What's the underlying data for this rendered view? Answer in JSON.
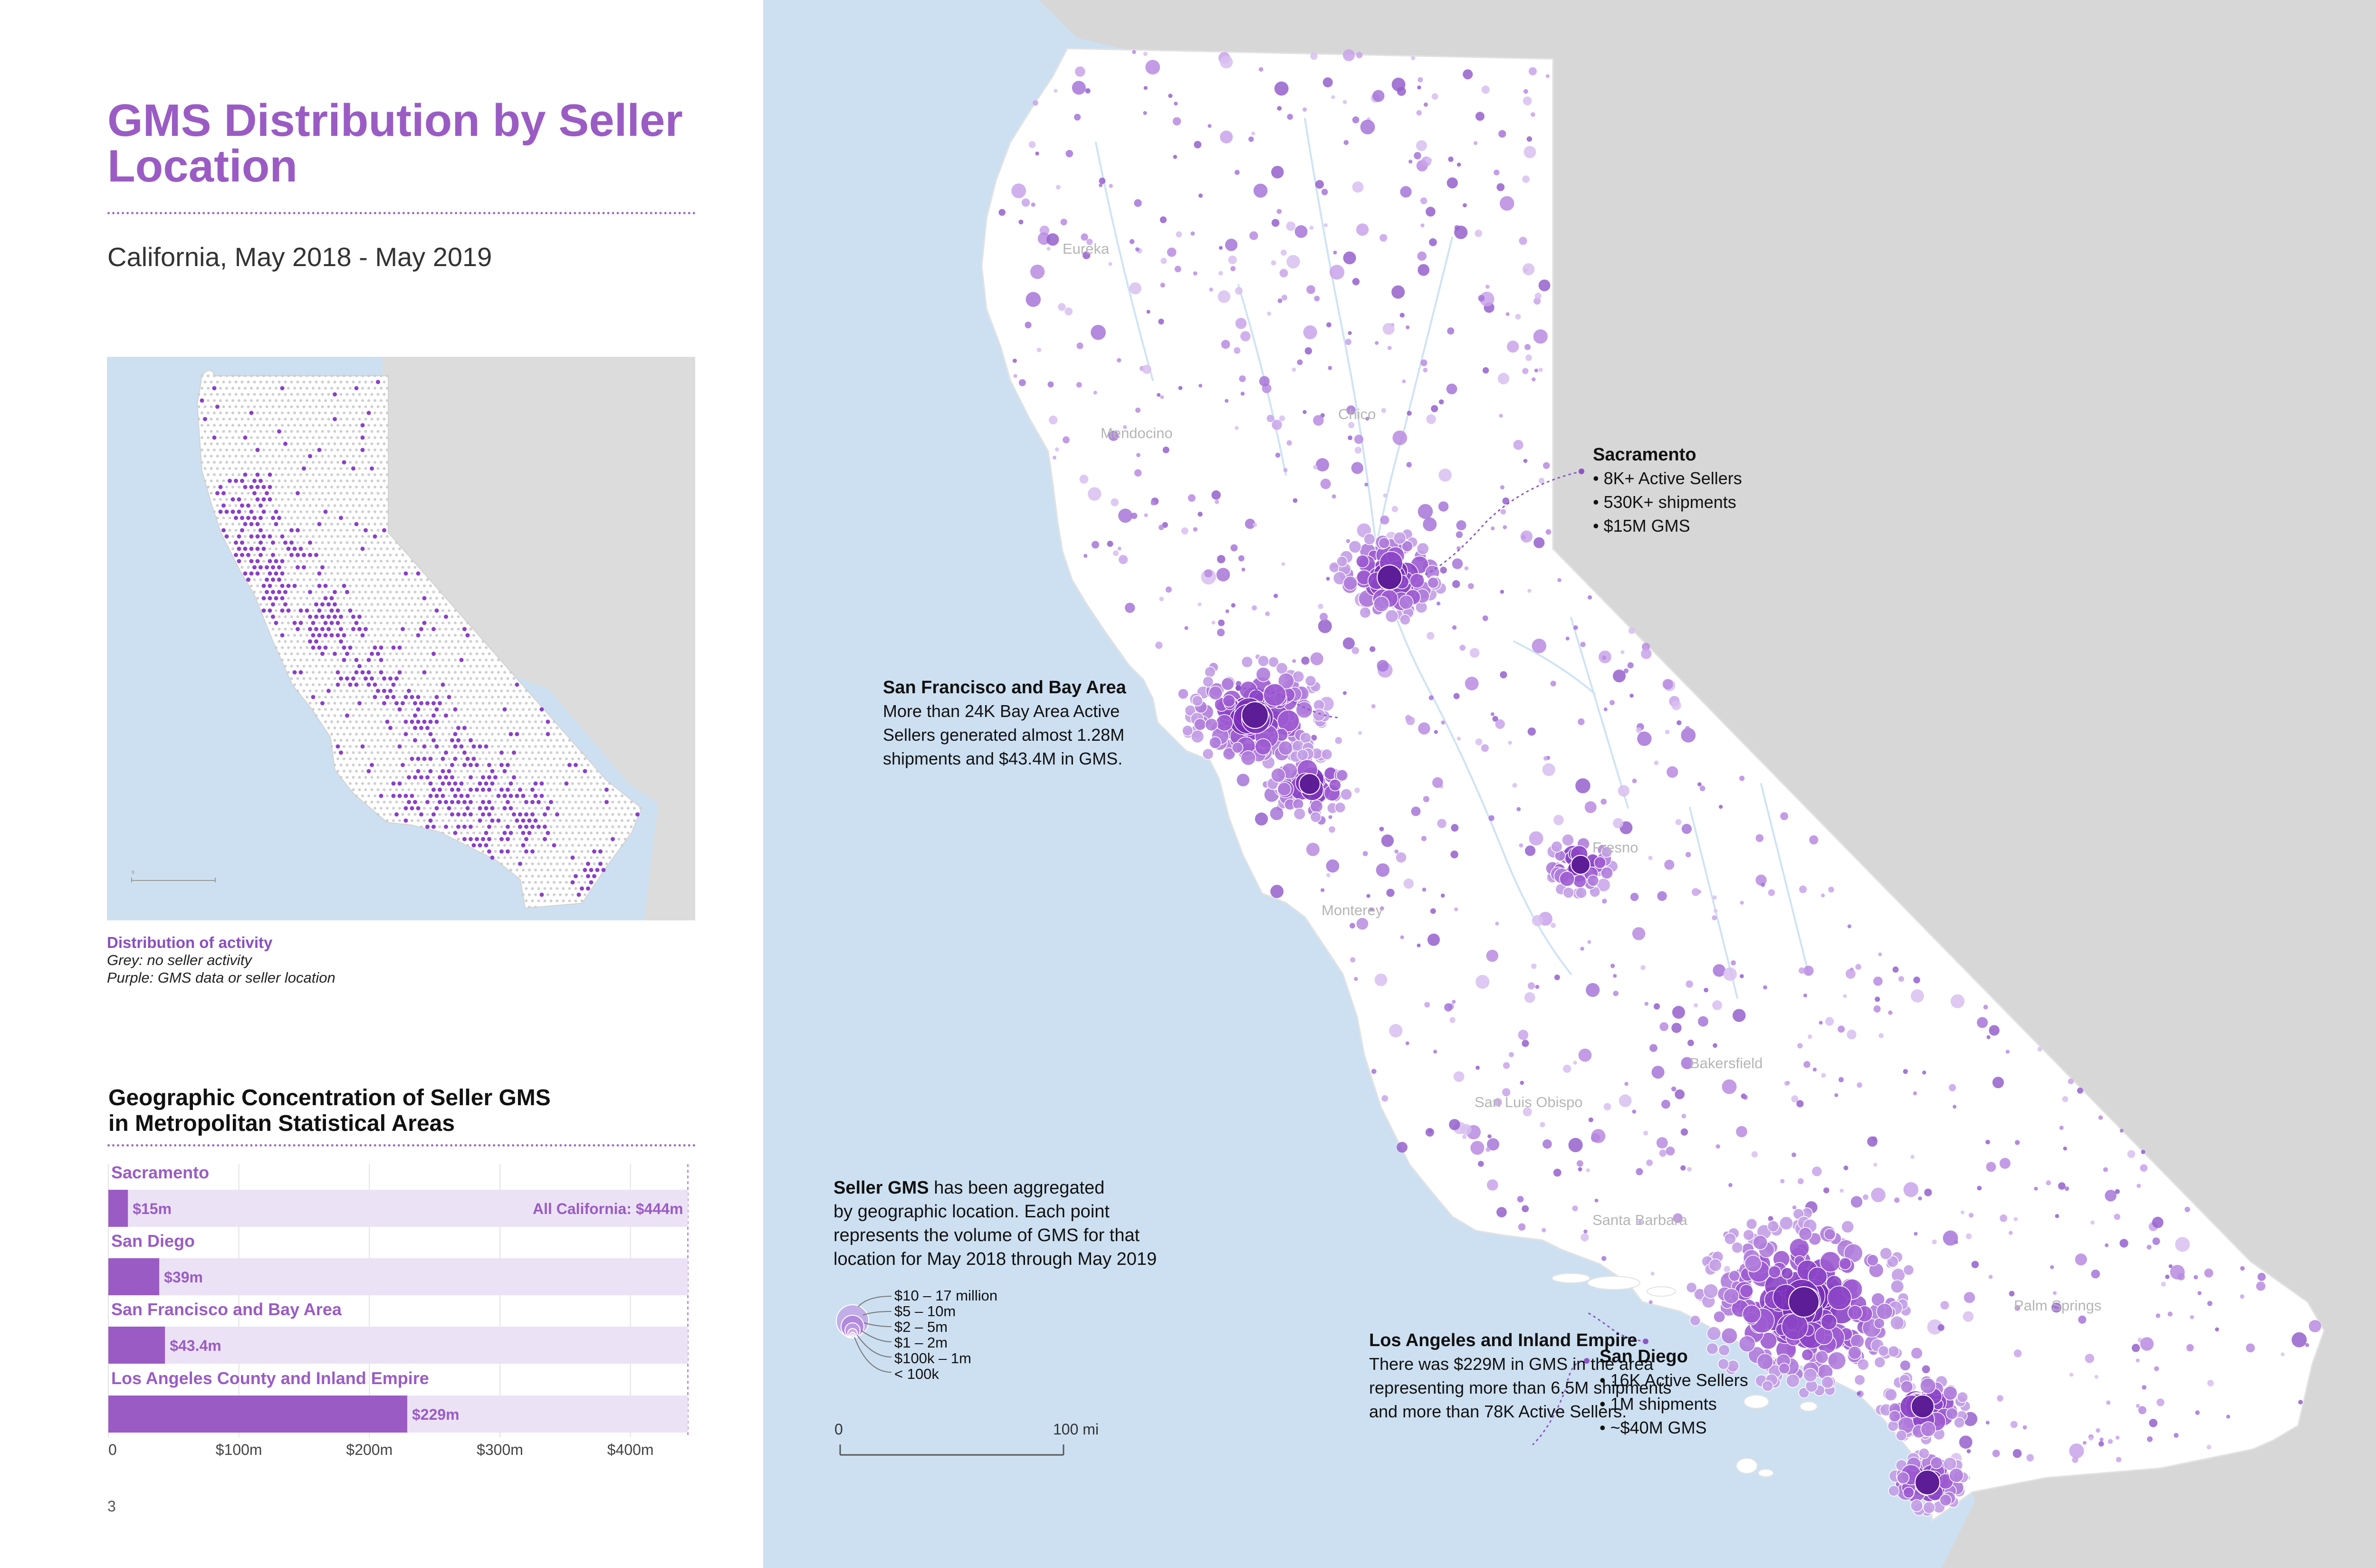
{
  "title": "GMS Distribution by Seller Location",
  "subtitle": "California, May 2018 - May 2019",
  "page_number": "3",
  "colors": {
    "accent": "#9a5cc4",
    "purple_dark": "#6a22a8",
    "purple_mid": "#9d5bd2",
    "purple_light": "#d8c3ee",
    "ocean": "#cde0f2",
    "land_outside": "#dcdcdc",
    "land_ca": "#ffffff"
  },
  "inset": {
    "caption_title": "Distribution of activity",
    "caption_lines": [
      "Grey: no seller activity",
      "Purple: GMS data or seller location"
    ]
  },
  "bar_chart_section": {
    "title_line1": "Geographic Concentration of Seller GMS",
    "title_line2": "in Metropolitan Statistical Areas",
    "total_label": "All California: $444m"
  },
  "chart_data": {
    "type": "bar",
    "orientation": "horizontal",
    "title": "Geographic Concentration of Seller GMS in Metropolitan Statistical Areas",
    "categories": [
      "Sacramento",
      "San Diego",
      "San Francisco and Bay Area",
      "Los Angeles County and Inland Empire"
    ],
    "values": [
      15,
      39,
      43.4,
      229
    ],
    "value_labels": [
      "$15m",
      "$39m",
      "$43.4m",
      "$229m"
    ],
    "total": 444,
    "total_label": "All California: $444m",
    "xlim": [
      0,
      450
    ],
    "xticks": [
      0,
      100,
      200,
      300,
      400
    ],
    "xtick_labels": [
      "0",
      "$100m",
      "$200m",
      "$300m",
      "$400m"
    ],
    "grid": true
  },
  "map": {
    "city_labels": [
      "Eureka",
      "Chico",
      "Mendocino",
      "Fresno",
      "Monterey",
      "Bakersfield",
      "San Luis Obispo",
      "Santa Barbara",
      "Palm Springs"
    ],
    "callouts": {
      "sacramento": {
        "title": "Sacramento",
        "lines": [
          "• 8K+ Active Sellers",
          "• 530K+ shipments",
          "• $15M GMS"
        ]
      },
      "sf": {
        "title": "San Francisco and Bay Area",
        "lines": [
          "More than 24K Bay Area Active",
          "Sellers generated almost 1.28M",
          "shipments and $43.4M in GMS."
        ]
      },
      "la": {
        "title": "Los Angeles and Inland Empire",
        "lines": [
          "There was $229M in GMS in the area",
          "representing more than 6.5M shipments",
          "and more than 78K Active Sellers."
        ]
      },
      "sd": {
        "title": "San Diego",
        "lines": [
          "• 16K Active Sellers",
          "• 1M shipments",
          "• ~$40M GMS"
        ]
      }
    },
    "legend": {
      "bold": "Seller GMS",
      "rest_line1": " has been aggregated",
      "lines": [
        "by geographic location. Each point",
        "represents the volume of GMS for that",
        "location for May 2018 through May 2019"
      ],
      "sizes": [
        "$10 – 17 million",
        "$5 – 10m",
        "$2 – 5m",
        "$1 – 2m",
        "$100k – 1m",
        "< 100k"
      ]
    },
    "scale": {
      "start": "0",
      "end": "100 mi"
    }
  }
}
